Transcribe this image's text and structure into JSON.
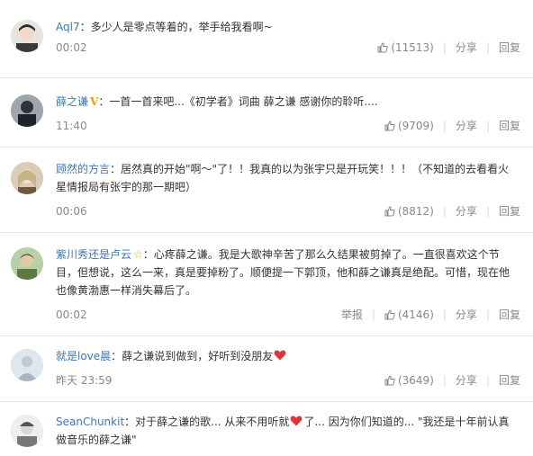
{
  "comments": [
    {
      "username": "Aql7",
      "text": "多少人是零点等着的，举手给我看啊~",
      "time": "00:02",
      "likes": "(11513)",
      "share": "分享",
      "reply": "回复"
    },
    {
      "username": "薛之谦",
      "badge": "V",
      "text": "一首一首来吧...《初学者》词曲 薛之谦 感谢你的聆听....",
      "time": "11:40",
      "likes": "(9709)",
      "share": "分享",
      "reply": "回复"
    },
    {
      "username": "顾然的方言",
      "text": "居然真的开始\"啊～\"了！！我真的以为张宇只是开玩笑！！！（不知道的去看看火星情报局有张宇的那一期吧）",
      "time": "00:06",
      "likes": "(8812)",
      "share": "分享",
      "reply": "回复"
    },
    {
      "username": "紫川秀还是卢云",
      "badge": "☆",
      "text": "心疼薛之谦。我是大歌神辛苦了那么久结果被剪掉了。一直很喜欢这个节目，但想说，这么一来，真是要掉粉了。顺便提一下郭顶，他和薛之谦真是绝配。可惜，现在他也像黄渤惠一样消失幕后了。",
      "time": "00:02",
      "report": "举报",
      "likes": "(4146)",
      "share": "分享",
      "reply": "回复"
    },
    {
      "username": "就是love晨",
      "text_before": "薛之谦说到做到，好听到没朋友",
      "time": "昨天 23:59",
      "likes": "(3649)",
      "share": "分享",
      "reply": "回复"
    },
    {
      "username": "SeanChunkit",
      "text_before": "对于薛之谦的歌... 从来不用听就",
      "text_after": "了... 因为你们知道的... \"我还是十年前认真做音乐的薛之谦\""
    }
  ],
  "colors": {
    "username": "#3b77b8",
    "meta": "#888888",
    "heart": "#e0343a",
    "v_badge": "#e8a000"
  },
  "icons": [
    "avatar",
    "v-badge-icon",
    "star-badge-icon",
    "thumb-up-icon",
    "heart-icon"
  ]
}
